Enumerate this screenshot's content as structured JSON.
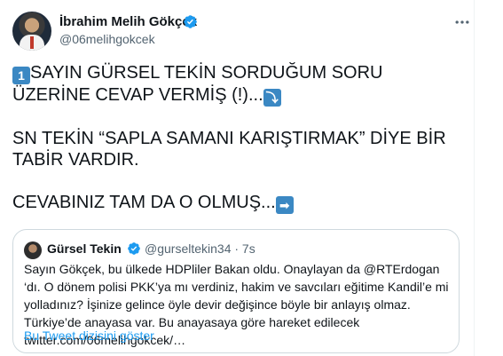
{
  "author": {
    "display_name": "İbrahim Melih Gökçek",
    "handle": "@06melihgokcek"
  },
  "tweet": {
    "line1_emoji": "1",
    "line1_text": "SAYIN GÜRSEL TEKİN SORDUĞUM SORU ÜZERİNE CEVAP VERMİŞ (!)...",
    "line1_end_emoji": "⤵",
    "line2_text": "SN TEKİN “SAPLA SAMANI KARIŞTIRMAK” DİYE BİR TABİR VARDIR.",
    "line3_text": "CEVABINIZ TAM DA O OLMUŞ...",
    "line3_end_emoji": "➡"
  },
  "quote": {
    "display_name": "Gürsel Tekin",
    "handle_time": "@gurseltekin34 · 7s",
    "text": "Sayın Gökçek, bu ülkede HDPliler Bakan oldu. Onaylayan da @RTErdogan ‘dı. O dönem polisi PKK’ya mı verdiniz, hakim ve savcıları eğitime Kandil’e mi yolladınız? İşinize gelince öyle devir değişince böyle bir anlayış olmaz. Türkiye’de anayasa var. Bu anayasaya göre hareket edilecek  twitter.com/06melihgokcek/…",
    "show_thread": "Bu Tweet dizisini göster"
  },
  "colors": {
    "accent": "#1d9bf0",
    "text_primary": "#0f1419",
    "text_secondary": "#536471",
    "border": "#cfd9de",
    "emoji_blue": "#3b88c3"
  },
  "icons": {
    "verified": "verified-badge-icon",
    "more": "more-horizontal-icon"
  }
}
